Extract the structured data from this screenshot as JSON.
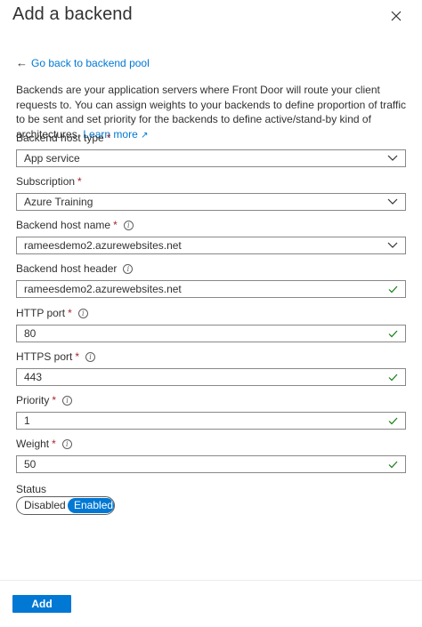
{
  "header": {
    "title": "Add a backend"
  },
  "back_link": {
    "label": "Go back to backend pool"
  },
  "description": {
    "text": "Backends are your application servers where Front Door will route your client requests to. You can assign weights to your backends to define proportion of traffic to be sent and set priority for the backends to define active/stand-by kind of architectures.",
    "link": "Learn more"
  },
  "fields": {
    "host_type": {
      "label": "Backend host type",
      "value": "App service"
    },
    "subscription": {
      "label": "Subscription",
      "value": "Azure Training"
    },
    "host_name": {
      "label": "Backend host name",
      "value": "rameesdemo2.azurewebsites.net"
    },
    "host_header": {
      "label": "Backend host header",
      "value": "rameesdemo2.azurewebsites.net"
    },
    "http_port": {
      "label": "HTTP port",
      "value": "80"
    },
    "https_port": {
      "label": "HTTPS port",
      "value": "443"
    },
    "priority": {
      "label": "Priority",
      "value": "1"
    },
    "weight": {
      "label": "Weight",
      "value": "50"
    }
  },
  "status": {
    "label": "Status",
    "disabled": "Disabled",
    "enabled": "Enabled",
    "selected": "Enabled"
  },
  "footer": {
    "add_label": "Add"
  },
  "required_marker": "*",
  "info_glyph": "i",
  "colors": {
    "accent": "#0078d4",
    "required": "#a4262c",
    "valid": "#107c10"
  }
}
